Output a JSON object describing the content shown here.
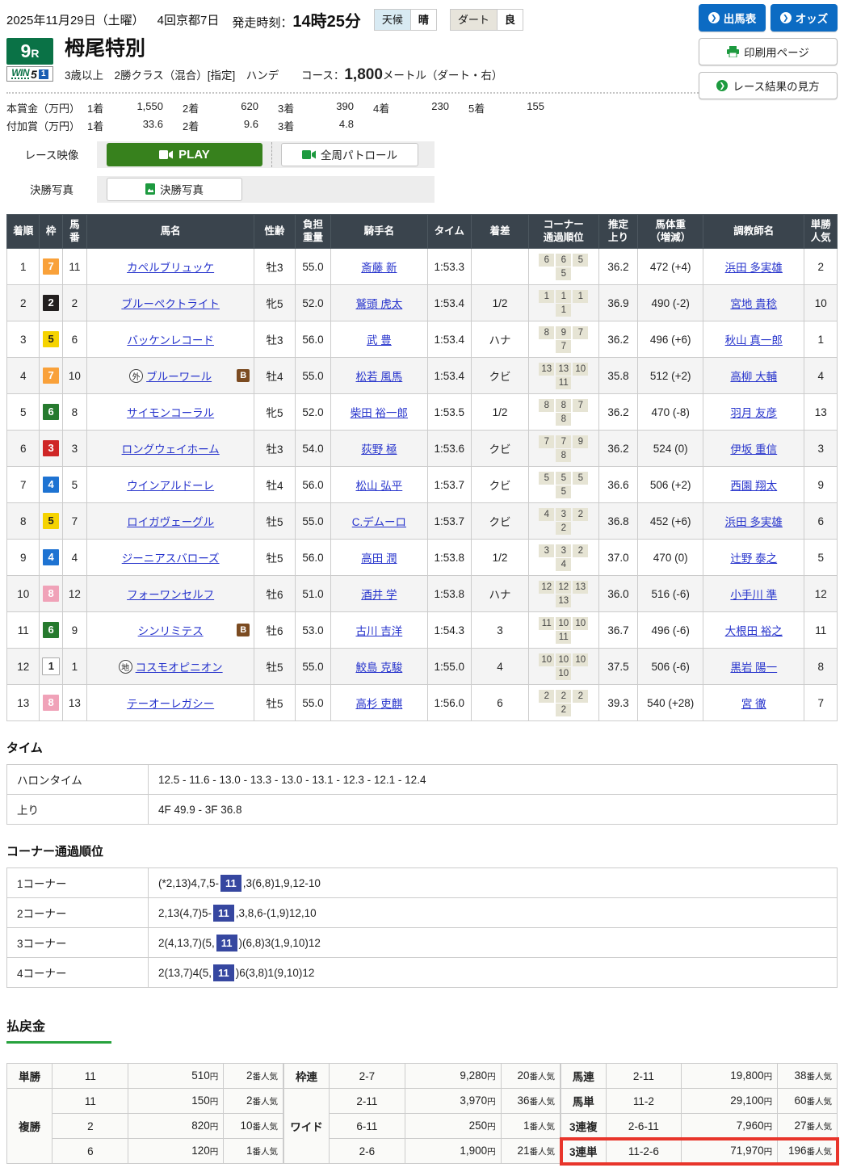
{
  "header": {
    "date": "2025年11月29日（土曜）",
    "meeting": "4回京都7日",
    "start_label": "発走時刻：",
    "start_time": "14時25分",
    "weather_label": "天候",
    "weather_value": "晴",
    "track_label": "ダート",
    "track_value": "良",
    "buttons": {
      "entries": "出馬表",
      "odds": "オッズ",
      "print": "印刷用ページ",
      "guide": "レース結果の見方"
    }
  },
  "race": {
    "number": "9",
    "number_suffix": "R",
    "win5_text": "WIN",
    "win5_five": "5",
    "win5_num": "1",
    "name": "栂尾特別",
    "conditions": "3歳以上　2勝クラス（混合）[指定]　ハンデ",
    "course_label": "コース：",
    "course_value": "1,800",
    "course_unit": "メートル（ダート・右）"
  },
  "prizes": {
    "main_label": "本賞金（万円）",
    "main": [
      {
        "pos": "1着",
        "val": "1,550"
      },
      {
        "pos": "2着",
        "val": "620"
      },
      {
        "pos": "3着",
        "val": "390"
      },
      {
        "pos": "4着",
        "val": "230"
      },
      {
        "pos": "5着",
        "val": "155"
      }
    ],
    "added_label": "付加賞（万円）",
    "added": [
      {
        "pos": "1着",
        "val": "33.6"
      },
      {
        "pos": "2着",
        "val": "9.6"
      },
      {
        "pos": "3着",
        "val": "4.8"
      }
    ]
  },
  "media": {
    "race_video_label": "レース映像",
    "play_button": "PLAY",
    "patrol_button": "全周パトロール",
    "photo_label": "決勝写真",
    "photo_button": "決勝写真"
  },
  "results": {
    "headers": [
      [
        "着順"
      ],
      [
        "枠"
      ],
      [
        "馬",
        "番"
      ],
      [
        "馬名"
      ],
      [
        "性齢"
      ],
      [
        "負担",
        "重量"
      ],
      [
        "騎手名"
      ],
      [
        "タイム"
      ],
      [
        "着差"
      ],
      [
        "コーナー",
        "通過順位"
      ],
      [
        "推定",
        "上り"
      ],
      [
        "馬体重",
        "（増減）"
      ],
      [
        "調教師名"
      ],
      [
        "単勝",
        "人気"
      ]
    ],
    "rows": [
      {
        "pos": "1",
        "frame": "7",
        "no": "11",
        "mark": "",
        "name": "カペルブリュッケ",
        "blinker": false,
        "sex_age": "牡3",
        "weight": "55.0",
        "jockey": "斎藤 新",
        "time": "1:53.3",
        "margin": "",
        "corners": [
          "6",
          "6",
          "5",
          "5"
        ],
        "last3f": "36.2",
        "body": "472 (+4)",
        "trainer": "浜田 多実雄",
        "fav": "2"
      },
      {
        "pos": "2",
        "frame": "2",
        "no": "2",
        "mark": "",
        "name": "ブルーペクトライト",
        "blinker": false,
        "sex_age": "牝5",
        "weight": "52.0",
        "jockey": "鷲頭 虎太",
        "time": "1:53.4",
        "margin": "1/2",
        "corners": [
          "1",
          "1",
          "1",
          "1"
        ],
        "last3f": "36.9",
        "body": "490 (-2)",
        "trainer": "宮地 貴稔",
        "fav": "10"
      },
      {
        "pos": "3",
        "frame": "5",
        "no": "6",
        "mark": "",
        "name": "バッケンレコード",
        "blinker": false,
        "sex_age": "牡3",
        "weight": "56.0",
        "jockey": "武 豊",
        "time": "1:53.4",
        "margin": "ハナ",
        "corners": [
          "8",
          "9",
          "7",
          "7"
        ],
        "last3f": "36.2",
        "body": "496 (+6)",
        "trainer": "秋山 真一郎",
        "fav": "1"
      },
      {
        "pos": "4",
        "frame": "7",
        "no": "10",
        "mark": "外",
        "name": "ブルーワール",
        "blinker": true,
        "sex_age": "牡4",
        "weight": "55.0",
        "jockey": "松若 風馬",
        "time": "1:53.4",
        "margin": "クビ",
        "corners": [
          "13",
          "13",
          "10",
          "11"
        ],
        "last3f": "35.8",
        "body": "512 (+2)",
        "trainer": "高柳 大輔",
        "fav": "4"
      },
      {
        "pos": "5",
        "frame": "6",
        "no": "8",
        "mark": "",
        "name": "サイモンコーラル",
        "blinker": false,
        "sex_age": "牝5",
        "weight": "52.0",
        "jockey": "柴田 裕一郎",
        "time": "1:53.5",
        "margin": "1/2",
        "corners": [
          "8",
          "8",
          "7",
          "8"
        ],
        "last3f": "36.2",
        "body": "470 (-8)",
        "trainer": "羽月 友彦",
        "fav": "13"
      },
      {
        "pos": "6",
        "frame": "3",
        "no": "3",
        "mark": "",
        "name": "ロングウェイホーム",
        "blinker": false,
        "sex_age": "牡3",
        "weight": "54.0",
        "jockey": "荻野 極",
        "time": "1:53.6",
        "margin": "クビ",
        "corners": [
          "7",
          "7",
          "9",
          "8"
        ],
        "last3f": "36.2",
        "body": "524 (0)",
        "trainer": "伊坂 重信",
        "fav": "3"
      },
      {
        "pos": "7",
        "frame": "4",
        "no": "5",
        "mark": "",
        "name": "ウインアルドーレ",
        "blinker": false,
        "sex_age": "牡4",
        "weight": "56.0",
        "jockey": "松山 弘平",
        "time": "1:53.7",
        "margin": "クビ",
        "corners": [
          "5",
          "5",
          "5",
          "5"
        ],
        "last3f": "36.6",
        "body": "506 (+2)",
        "trainer": "西園 翔太",
        "fav": "9"
      },
      {
        "pos": "8",
        "frame": "5",
        "no": "7",
        "mark": "",
        "name": "ロイガヴェーグル",
        "blinker": false,
        "sex_age": "牡5",
        "weight": "55.0",
        "jockey": "C.デムーロ",
        "time": "1:53.7",
        "margin": "クビ",
        "corners": [
          "4",
          "3",
          "2",
          "2"
        ],
        "last3f": "36.8",
        "body": "452 (+6)",
        "trainer": "浜田 多実雄",
        "fav": "6"
      },
      {
        "pos": "9",
        "frame": "4",
        "no": "4",
        "mark": "",
        "name": "ジーニアスバローズ",
        "blinker": false,
        "sex_age": "牡5",
        "weight": "56.0",
        "jockey": "高田 潤",
        "time": "1:53.8",
        "margin": "1/2",
        "corners": [
          "3",
          "3",
          "2",
          "4"
        ],
        "last3f": "37.0",
        "body": "470 (0)",
        "trainer": "辻野 泰之",
        "fav": "5"
      },
      {
        "pos": "10",
        "frame": "8",
        "no": "12",
        "mark": "",
        "name": "フォーワンセルフ",
        "blinker": false,
        "sex_age": "牡6",
        "weight": "51.0",
        "jockey": "酒井 学",
        "time": "1:53.8",
        "margin": "ハナ",
        "corners": [
          "12",
          "12",
          "13",
          "13"
        ],
        "last3f": "36.0",
        "body": "516 (-6)",
        "trainer": "小手川 準",
        "fav": "12"
      },
      {
        "pos": "11",
        "frame": "6",
        "no": "9",
        "mark": "",
        "name": "シンリミテス",
        "blinker": true,
        "sex_age": "牡6",
        "weight": "53.0",
        "jockey": "古川 吉洋",
        "time": "1:54.3",
        "margin": "3",
        "corners": [
          "11",
          "10",
          "10",
          "11"
        ],
        "last3f": "36.7",
        "body": "496 (-6)",
        "trainer": "大根田 裕之",
        "fav": "11"
      },
      {
        "pos": "12",
        "frame": "1",
        "no": "1",
        "mark": "地",
        "name": "コスモオピニオン",
        "blinker": false,
        "sex_age": "牡5",
        "weight": "55.0",
        "jockey": "鮫島 克駿",
        "time": "1:55.0",
        "margin": "4",
        "corners": [
          "10",
          "10",
          "10",
          "10"
        ],
        "last3f": "37.5",
        "body": "506 (-6)",
        "trainer": "黒岩 陽一",
        "fav": "8"
      },
      {
        "pos": "13",
        "frame": "8",
        "no": "13",
        "mark": "",
        "name": "テーオーレガシー",
        "blinker": false,
        "sex_age": "牡5",
        "weight": "55.0",
        "jockey": "高杉 吏麒",
        "time": "1:56.0",
        "margin": "6",
        "corners": [
          "2",
          "2",
          "2",
          "2"
        ],
        "last3f": "39.3",
        "body": "540 (+28)",
        "trainer": "宮 徹",
        "fav": "7"
      }
    ]
  },
  "frame_colors": {
    "1": {
      "bg": "#ffffff",
      "fg": "#222222",
      "border": "#aaaaaa"
    },
    "2": {
      "bg": "#221f1f",
      "fg": "#ffffff",
      "border": ""
    },
    "3": {
      "bg": "#cf2626",
      "fg": "#ffffff",
      "border": ""
    },
    "4": {
      "bg": "#1e73d2",
      "fg": "#ffffff",
      "border": ""
    },
    "5": {
      "bg": "#f5d300",
      "fg": "#222222",
      "border": ""
    },
    "6": {
      "bg": "#267a2e",
      "fg": "#ffffff",
      "border": ""
    },
    "7": {
      "bg": "#f9a13a",
      "fg": "#ffffff",
      "border": ""
    },
    "8": {
      "bg": "#f0a2b8",
      "fg": "#ffffff",
      "border": ""
    }
  },
  "time_section": {
    "title": "タイム",
    "rows": [
      {
        "label": "ハロンタイム",
        "value": "12.5 - 11.6 - 13.0 - 13.3 - 13.0 - 13.1 - 12.3 - 12.1 - 12.4"
      },
      {
        "label": "上り",
        "value": "4F 49.9 - 3F 36.8"
      }
    ]
  },
  "corner_section": {
    "title": "コーナー通過順位",
    "rows": [
      {
        "label": "1コーナー",
        "before": "(*2,13)4,7,5-",
        "highlight": "11",
        "after": ",3(6,8)1,9,12-10"
      },
      {
        "label": "2コーナー",
        "before": "2,13(4,7)5-",
        "highlight": "11",
        "after": ",3,8,6-(1,9)12,10"
      },
      {
        "label": "3コーナー",
        "before": "2(4,13,7)(5,",
        "highlight": "11",
        "after": ")(6,8)3(1,9,10)12"
      },
      {
        "label": "4コーナー",
        "before": "2(13,7)4(5,",
        "highlight": "11",
        "after": ")6(3,8)1(9,10)12"
      }
    ]
  },
  "payout_section": {
    "title": "払戻金",
    "yen_suffix": "円",
    "fav_suffix": "番人気",
    "blocks": [
      {
        "groups": [
          {
            "type": "単勝",
            "rows": [
              {
                "combo": "11",
                "amount": "510",
                "fav": "2"
              }
            ]
          },
          {
            "type": "複勝",
            "rows": [
              {
                "combo": "11",
                "amount": "150",
                "fav": "2"
              },
              {
                "combo": "2",
                "amount": "820",
                "fav": "10"
              },
              {
                "combo": "6",
                "amount": "120",
                "fav": "1"
              }
            ]
          }
        ]
      },
      {
        "groups": [
          {
            "type": "枠連",
            "rows": [
              {
                "combo": "2-7",
                "amount": "9,280",
                "fav": "20"
              }
            ]
          },
          {
            "type": "ワイド",
            "rows": [
              {
                "combo": "2-11",
                "amount": "3,970",
                "fav": "36"
              },
              {
                "combo": "6-11",
                "amount": "250",
                "fav": "1"
              },
              {
                "combo": "2-6",
                "amount": "1,900",
                "fav": "21"
              }
            ]
          }
        ]
      },
      {
        "groups": [
          {
            "type": "馬連",
            "rows": [
              {
                "combo": "2-11",
                "amount": "19,800",
                "fav": "38"
              }
            ]
          },
          {
            "type": "馬単",
            "rows": [
              {
                "combo": "11-2",
                "amount": "29,100",
                "fav": "60"
              }
            ]
          },
          {
            "type": "3連複",
            "rows": [
              {
                "combo": "2-6-11",
                "amount": "7,960",
                "fav": "27"
              }
            ]
          },
          {
            "type": "3連単",
            "highlight": true,
            "rows": [
              {
                "combo": "11-2-6",
                "amount": "71,970",
                "fav": "196"
              }
            ]
          }
        ]
      }
    ]
  },
  "colors": {
    "accent_green": "#0a7246",
    "button_blue": "#0c6bc3",
    "play_green": "#37811d",
    "highlight_red": "#e8352b",
    "corner_badge_blue": "#3647a0"
  }
}
